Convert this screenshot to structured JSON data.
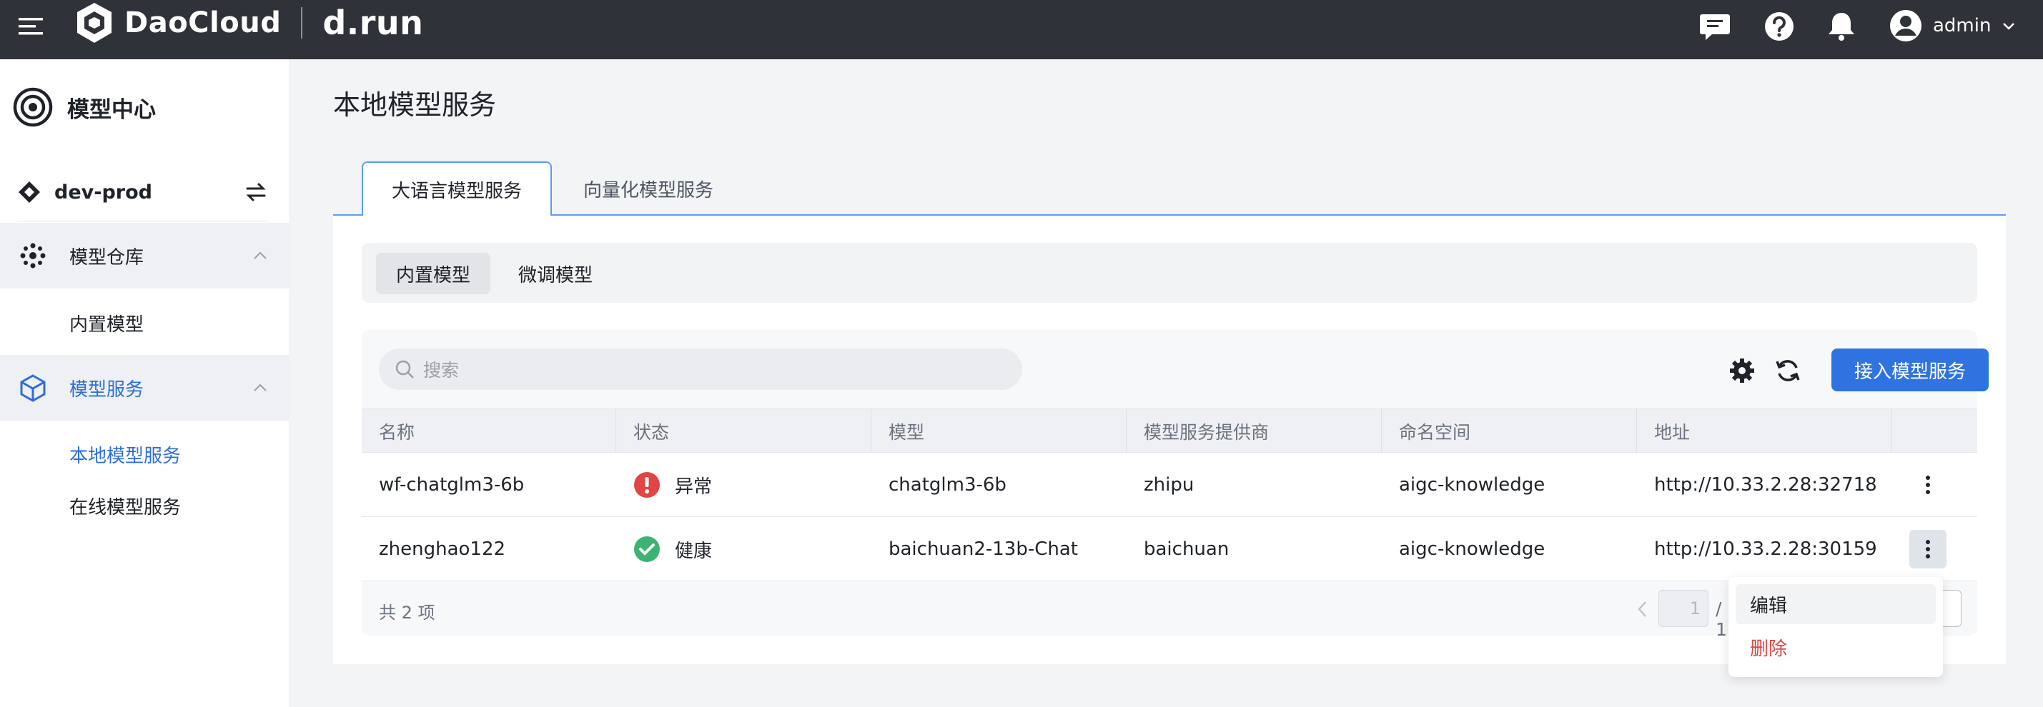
{
  "topbar": {
    "brand_name": "DaoCloud",
    "brand_sub": "d.run",
    "user_name": "admin",
    "icons": [
      "menu-icon",
      "message-icon",
      "help-icon",
      "bell-icon",
      "user-avatar-icon",
      "chevron-down-icon"
    ]
  },
  "sidebar": {
    "title": "模型中心",
    "workspace": "dev-prod",
    "groups": [
      {
        "label": "模型仓库",
        "icon": "model-repo-icon",
        "items": [
          {
            "label": "内置模型",
            "active": false
          }
        ]
      },
      {
        "label": "模型服务",
        "icon": "model-service-icon",
        "active": true,
        "items": [
          {
            "label": "本地模型服务",
            "active": true
          },
          {
            "label": "在线模型服务",
            "active": false
          }
        ]
      }
    ]
  },
  "main": {
    "page_title": "本地模型服务",
    "tabs": [
      {
        "label": "大语言模型服务",
        "active": true
      },
      {
        "label": "向量化模型服务",
        "active": false
      }
    ],
    "subtabs": [
      {
        "label": "内置模型",
        "active": true
      },
      {
        "label": "微调模型",
        "active": false
      }
    ],
    "search_placeholder": "搜索",
    "primary_button": "接入模型服务",
    "columns": [
      "名称",
      "状态",
      "模型",
      "模型服务提供商",
      "命名空间",
      "地址"
    ],
    "rows": [
      {
        "name": "wf-chatglm3-6b",
        "status": "异常",
        "status_type": "error",
        "model": "chatglm3-6b",
        "provider": "zhipu",
        "namespace": "aigc-knowledge",
        "address": "http://10.33.2.28:32718"
      },
      {
        "name": "zhenghao122",
        "status": "健康",
        "status_type": "ok",
        "model": "baichuan2-13b-Chat",
        "provider": "baichuan",
        "namespace": "aigc-knowledge",
        "address": "http://10.33.2.28:30159"
      }
    ],
    "total_text": "共 2 项",
    "pagination": {
      "current": "1",
      "total": "/ 1"
    },
    "dropdown": {
      "edit": "编辑",
      "delete": "删除"
    }
  },
  "colors": {
    "topbar": "#2f3238",
    "accent": "#2f73e0",
    "error": "#e04444",
    "success": "#3cb371"
  }
}
